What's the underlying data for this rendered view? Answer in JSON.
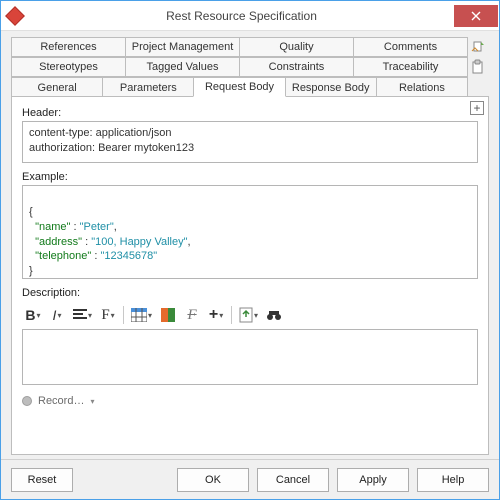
{
  "window": {
    "title": "Rest Resource Specification"
  },
  "tabs": {
    "row1": [
      "References",
      "Project Management",
      "Quality",
      "Comments"
    ],
    "row2": [
      "Stereotypes",
      "Tagged Values",
      "Constraints",
      "Traceability"
    ],
    "row3": [
      "General",
      "Parameters",
      "Request Body",
      "Response Body",
      "Relations"
    ],
    "active": "Request Body"
  },
  "labels": {
    "header": "Header:",
    "example": "Example:",
    "description": "Description:"
  },
  "header_value": "content-type: application/json\nauthorization: Bearer mytoken123",
  "example_json": {
    "open": "{",
    "close": "}",
    "pairs": [
      {
        "key": "\"name\"",
        "colon": " : ",
        "value": "\"Peter\"",
        "comma": ","
      },
      {
        "key": "\"address\"",
        "colon": " : ",
        "value": "\"100, Happy Valley\"",
        "comma": ","
      },
      {
        "key": "\"telephone\"",
        "colon": " : ",
        "value": "\"12345678\"",
        "comma": ""
      }
    ]
  },
  "toolbar": {
    "bold": "B",
    "italic": "I"
  },
  "record": {
    "label": "Record…"
  },
  "buttons": {
    "reset": "Reset",
    "ok": "OK",
    "cancel": "Cancel",
    "apply": "Apply",
    "help": "Help"
  }
}
